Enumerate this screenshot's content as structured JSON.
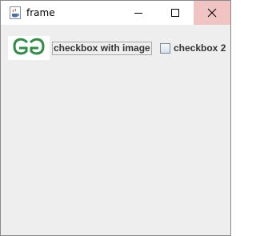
{
  "window": {
    "title": "frame",
    "app_icon": "java-cup-icon",
    "controls": [
      "minimize-icon",
      "maximize-icon",
      "close-icon"
    ]
  },
  "checkbox_1": {
    "label": "checkbox with image",
    "image": "geeksforgeeks-logo-icon",
    "checked": false
  },
  "checkbox_2": {
    "label": "checkbox 2",
    "checked": false
  },
  "colors": {
    "titlebar": "#ffffff",
    "content": "#eeeeee",
    "close_hover": "#f1c4c4",
    "logo_green": "#2f8d46"
  }
}
